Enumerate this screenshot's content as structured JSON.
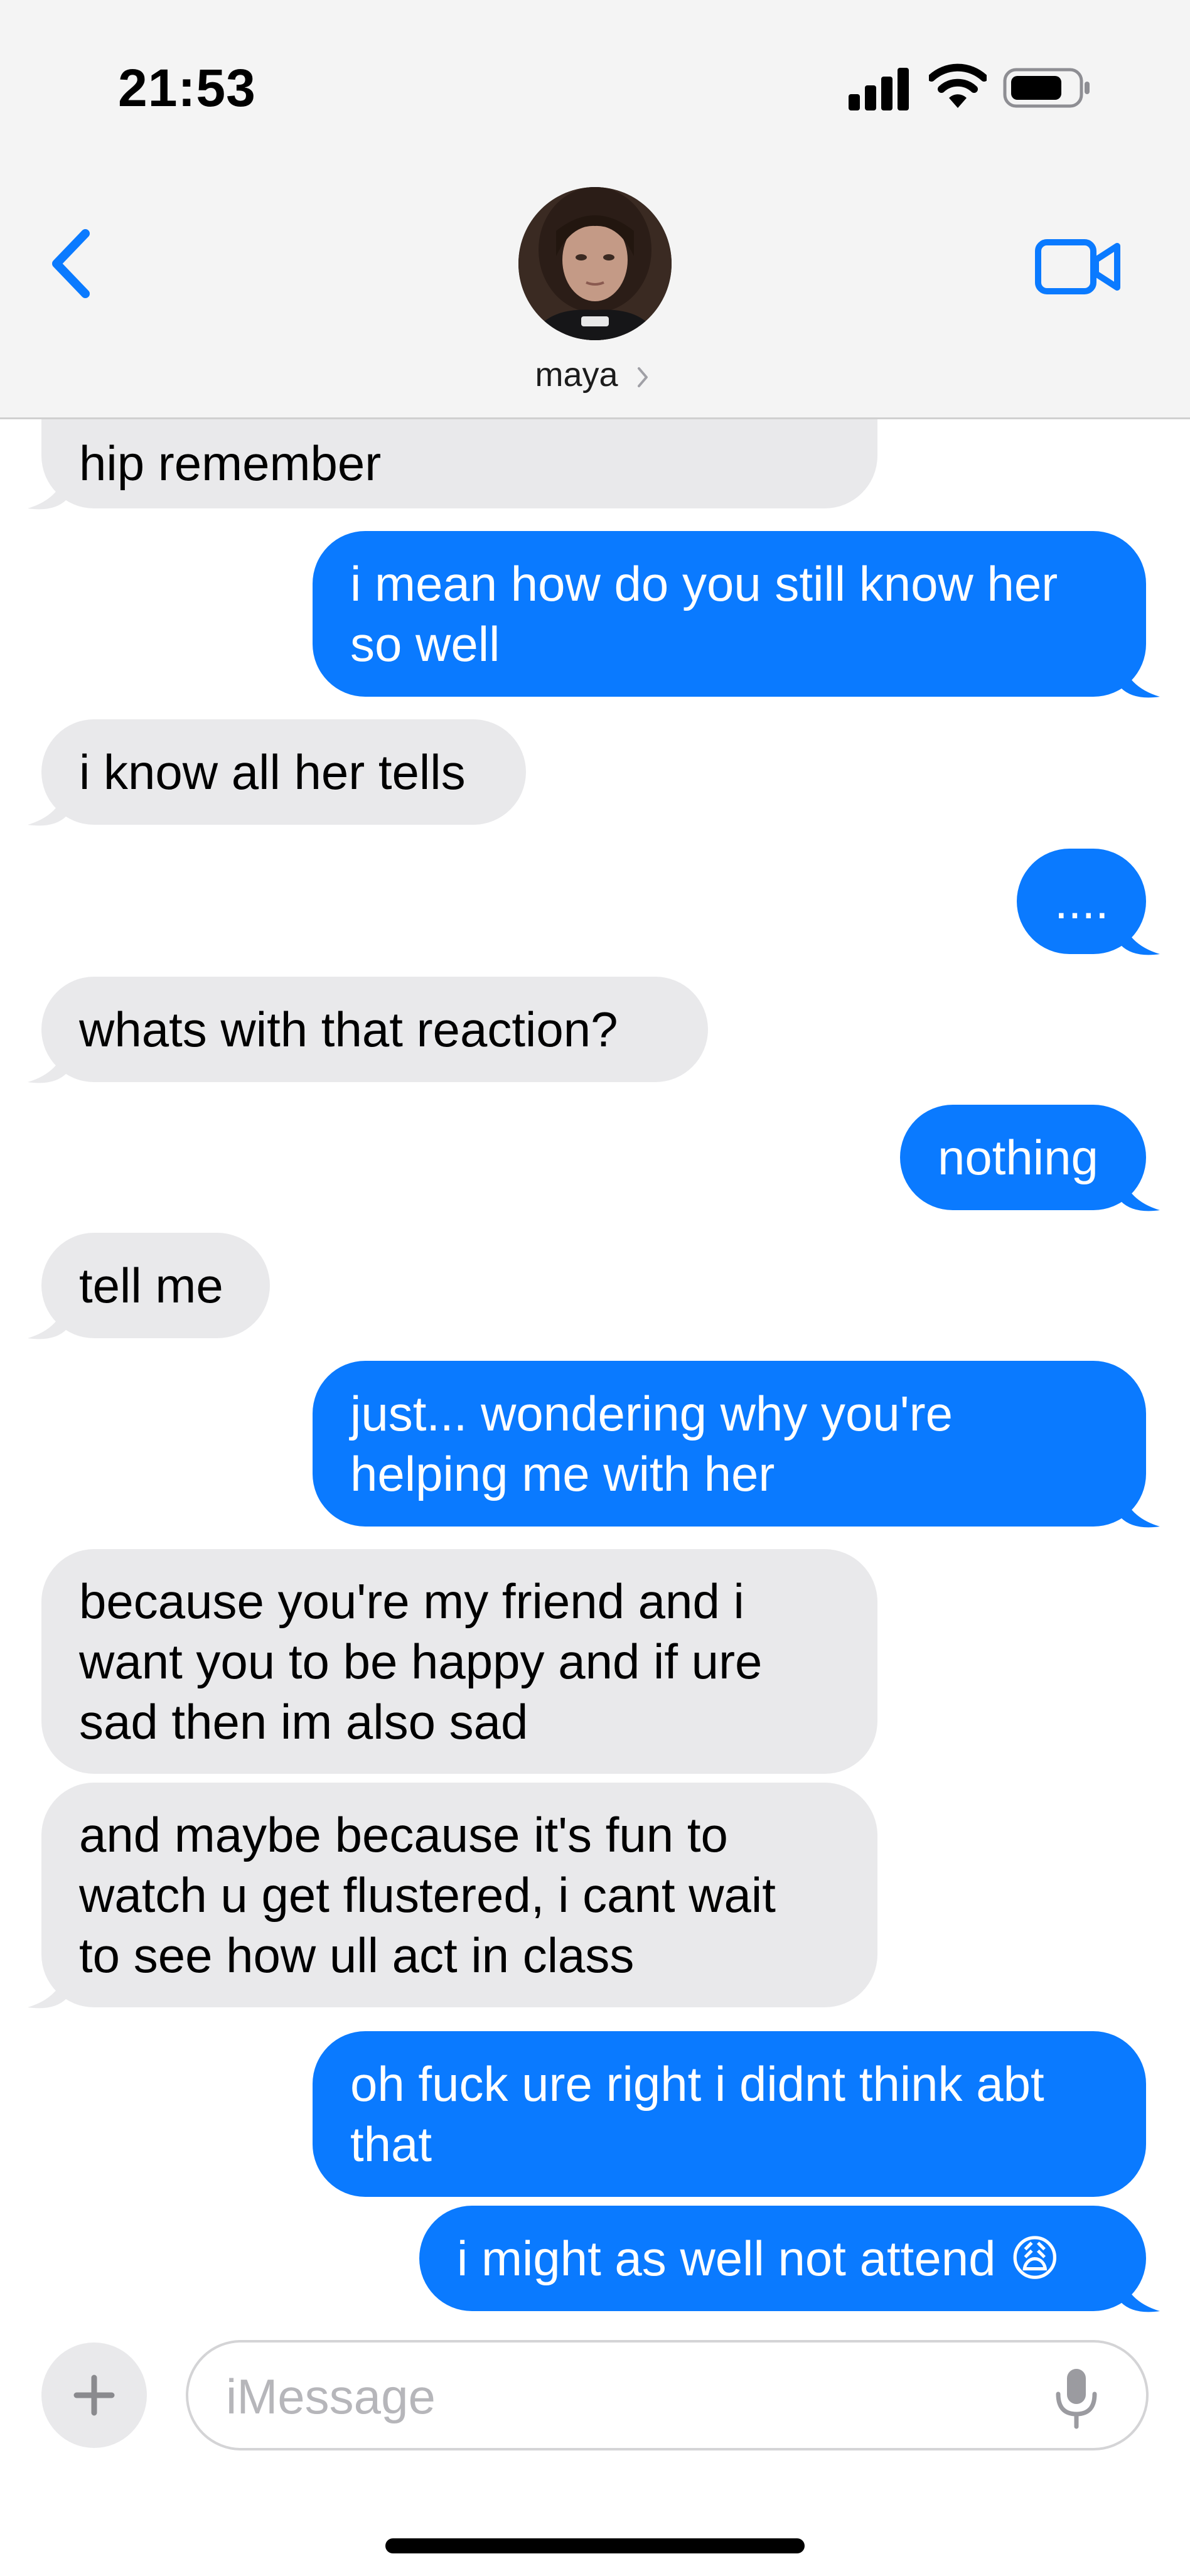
{
  "status_bar": {
    "time": "21:53"
  },
  "header": {
    "contact_name": "maya"
  },
  "messages": [
    {
      "id": 0,
      "side": "in",
      "lines": [
        "hip remember"
      ]
    },
    {
      "id": 1,
      "side": "out",
      "lines": [
        "i mean how do you still know her",
        "so well"
      ]
    },
    {
      "id": 2,
      "side": "in",
      "lines": [
        "i know all her tells"
      ]
    },
    {
      "id": 3,
      "side": "out",
      "lines": [
        "...."
      ]
    },
    {
      "id": 4,
      "side": "in",
      "lines": [
        "whats with that reaction?"
      ]
    },
    {
      "id": 5,
      "side": "out",
      "lines": [
        "nothing"
      ]
    },
    {
      "id": 6,
      "side": "in",
      "lines": [
        "tell me"
      ]
    },
    {
      "id": 7,
      "side": "out",
      "lines": [
        "just... wondering why you're",
        "helping me with her"
      ]
    },
    {
      "id": 8,
      "side": "in",
      "lines": [
        "because you're my friend and i",
        "want you to be happy and if ure",
        "sad then im also sad"
      ]
    },
    {
      "id": 9,
      "side": "in",
      "lines": [
        "and maybe because it's fun to",
        "watch u get flustered, i cant wait",
        "to see how ull act in class"
      ]
    },
    {
      "id": 10,
      "side": "out",
      "lines": [
        "oh fuck ure right i didnt think abt",
        "that"
      ]
    },
    {
      "id": 11,
      "side": "out",
      "lines": [
        "i might as well not attend 😩"
      ]
    }
  ],
  "composer": {
    "placeholder": "iMessage",
    "value": ""
  },
  "colors": {
    "outgoing_bubble": "#0a7aff",
    "incoming_bubble": "#e9e9eb",
    "accent": "#0a7aff",
    "header_bg": "#f4f4f4"
  },
  "icons": {
    "back": "chevron-left-icon",
    "video": "video-camera-icon",
    "add": "plus-icon",
    "mic": "microphone-icon"
  }
}
